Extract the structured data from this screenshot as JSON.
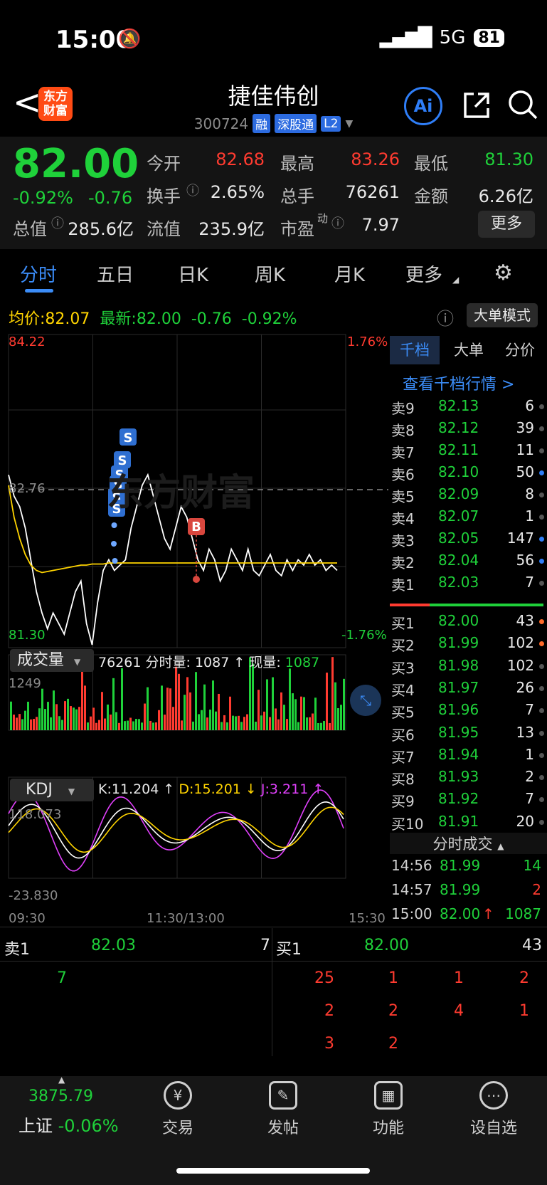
{
  "status_bar": {
    "time": "15:00",
    "network": "5G",
    "battery": "81"
  },
  "header": {
    "back": "<",
    "logo_text_1": "东方",
    "logo_text_2": "财富",
    "stock_name": "捷佳伟创",
    "stock_code": "300724",
    "tags": [
      "融",
      "深股通",
      "L2"
    ],
    "ai_label": "Ai"
  },
  "quote": {
    "price": "82.00",
    "change_pct": "-0.92%",
    "change_amt": "-0.76",
    "labels": {
      "open": "今开",
      "high": "最高",
      "low": "最低",
      "turnover": "换手",
      "volume": "总手",
      "amount": "金额",
      "mkt_cap": "总值",
      "float_cap": "流值",
      "pe": "市盈",
      "pe_sup": "动"
    },
    "open": "82.68",
    "high": "83.26",
    "low": "81.30",
    "turnover": "2.65%",
    "volume": "76261",
    "amount": "6.26亿",
    "mkt_cap": "285.6亿",
    "float_cap": "235.9亿",
    "pe": "7.97",
    "more": "更多"
  },
  "tabs": [
    "分时",
    "五日",
    "日K",
    "周K",
    "月K",
    "更多"
  ],
  "info_line": {
    "avg_label": "均价:",
    "avg": "82.07",
    "latest_label": "最新:",
    "latest": "82.00",
    "chg": "-0.76",
    "chg_pct": "-0.92%",
    "mode": "大单模式"
  },
  "chart_data": {
    "type": "line",
    "title": "",
    "y_top": "84.22",
    "y_bottom": "81.30",
    "pct_top": "1.76%",
    "pct_bottom": "-1.76%",
    "prev_close": "82.76",
    "x_labels": [
      "09:30",
      "11:30/13:00",
      "15:30"
    ],
    "ylim": [
      81.3,
      84.22
    ],
    "series": [
      {
        "values": [
          82.9,
          82.7,
          82.6,
          82.4,
          82.1,
          81.8,
          81.6,
          81.45,
          81.6,
          81.5,
          81.4,
          81.6,
          81.8,
          81.9,
          81.5,
          81.3,
          81.7,
          82.0,
          82.1,
          82.0,
          82.05,
          82.1,
          82.4,
          82.6,
          82.8,
          82.9,
          82.7,
          82.5,
          82.3,
          82.2,
          82.4,
          82.6,
          82.5,
          82.3,
          82.1,
          82.0,
          82.2,
          82.1,
          81.9,
          82.0,
          82.2,
          82.1,
          82.0,
          82.2,
          82.0,
          81.95,
          82.05,
          82.15,
          82.0,
          81.95,
          82.1,
          82.0,
          82.1,
          82.05,
          82.15,
          82.05,
          82.1,
          82.0,
          82.05,
          82.0
        ]
      },
      {
        "values": [
          82.8,
          82.5,
          82.3,
          82.15,
          82.05,
          82.0,
          81.98,
          81.99,
          82.0,
          82.01,
          82.02,
          82.03,
          82.04,
          82.05,
          82.05,
          82.06,
          82.06,
          82.06,
          82.07,
          82.07,
          82.07,
          82.07,
          82.07,
          82.07,
          82.07,
          82.07,
          82.07,
          82.07,
          82.07,
          82.07,
          82.07,
          82.07,
          82.07,
          82.07,
          82.07,
          82.07,
          82.07,
          82.07,
          82.07,
          82.07,
          82.07,
          82.07,
          82.07,
          82.07,
          82.07,
          82.07,
          82.07,
          82.07,
          82.07,
          82.07,
          82.07,
          82.07,
          82.07,
          82.07,
          82.07,
          82.07,
          82.07,
          82.07,
          82.07,
          82.07
        ]
      }
    ],
    "markers": [
      "S",
      "S",
      "S",
      "S",
      "S",
      "S",
      "B"
    ]
  },
  "volume": {
    "selector": "成交量",
    "total": "76261",
    "min_label": "分时量:",
    "min_vol": "1087 ↑",
    "now_label": "现量:",
    "now": "1087",
    "ymax": "1249"
  },
  "kdj": {
    "selector": "KDJ",
    "k": "K:11.204 ↑",
    "d": "D:15.201 ↓",
    "j": "J:3.211 ↑",
    "ymax": "118.073",
    "ymin": "-23.830"
  },
  "order_book": {
    "tabs": [
      "千档",
      "大单",
      "分价"
    ],
    "link": "查看千档行情 >",
    "asks": [
      {
        "label": "卖9",
        "price": "82.13",
        "qty": "6",
        "dot": "gray"
      },
      {
        "label": "卖8",
        "price": "82.12",
        "qty": "39",
        "dot": "gray"
      },
      {
        "label": "卖7",
        "price": "82.11",
        "qty": "11",
        "dot": "gray"
      },
      {
        "label": "卖6",
        "price": "82.10",
        "qty": "50",
        "dot": "blue"
      },
      {
        "label": "卖5",
        "price": "82.09",
        "qty": "8",
        "dot": "gray"
      },
      {
        "label": "卖4",
        "price": "82.07",
        "qty": "1",
        "dot": "gray"
      },
      {
        "label": "卖3",
        "price": "82.05",
        "qty": "147",
        "dot": "blue"
      },
      {
        "label": "卖2",
        "price": "82.04",
        "qty": "56",
        "dot": "blue"
      },
      {
        "label": "卖1",
        "price": "82.03",
        "qty": "7",
        "dot": "gray"
      }
    ],
    "bids": [
      {
        "label": "买1",
        "price": "82.00",
        "qty": "43",
        "dot": "orange"
      },
      {
        "label": "买2",
        "price": "81.99",
        "qty": "102",
        "dot": "orange"
      },
      {
        "label": "买3",
        "price": "81.98",
        "qty": "102",
        "dot": "gray"
      },
      {
        "label": "买4",
        "price": "81.97",
        "qty": "26",
        "dot": "gray"
      },
      {
        "label": "买5",
        "price": "81.96",
        "qty": "7",
        "dot": "gray"
      },
      {
        "label": "买6",
        "price": "81.95",
        "qty": "13",
        "dot": "gray"
      },
      {
        "label": "买7",
        "price": "81.94",
        "qty": "1",
        "dot": "gray"
      },
      {
        "label": "买8",
        "price": "81.93",
        "qty": "2",
        "dot": "gray"
      },
      {
        "label": "买9",
        "price": "81.92",
        "qty": "7",
        "dot": "gray"
      },
      {
        "label": "买10",
        "price": "81.91",
        "qty": "20",
        "dot": "gray"
      }
    ],
    "trades_title": "分时成交",
    "trades": [
      {
        "time": "14:56",
        "price": "81.99",
        "qty": "14",
        "arrow": ""
      },
      {
        "time": "14:57",
        "price": "81.99",
        "qty": "2",
        "arrow": ""
      },
      {
        "time": "15:00",
        "price": "82.00",
        "qty": "1087",
        "arrow": "↑"
      }
    ]
  },
  "queue": {
    "ask_label": "卖1",
    "ask_price": "82.03",
    "ask_qty": "7",
    "bid_label": "买1",
    "bid_price": "82.00",
    "bid_qty": "43",
    "ask_orders": [
      "7"
    ],
    "bid_orders": [
      "25",
      "1",
      "1",
      "2",
      "2",
      "2",
      "4",
      "1",
      "3",
      "2"
    ]
  },
  "bottom_nav": {
    "index_value": "3875.79",
    "index_name": "上证",
    "index_chg": "-0.06%",
    "items": [
      "交易",
      "发帖",
      "功能",
      "设自选"
    ]
  },
  "colors": {
    "up": "#ff3b30",
    "down": "#1fd13a",
    "accent": "#3b8cf7",
    "avg_line": "#ffd400"
  }
}
